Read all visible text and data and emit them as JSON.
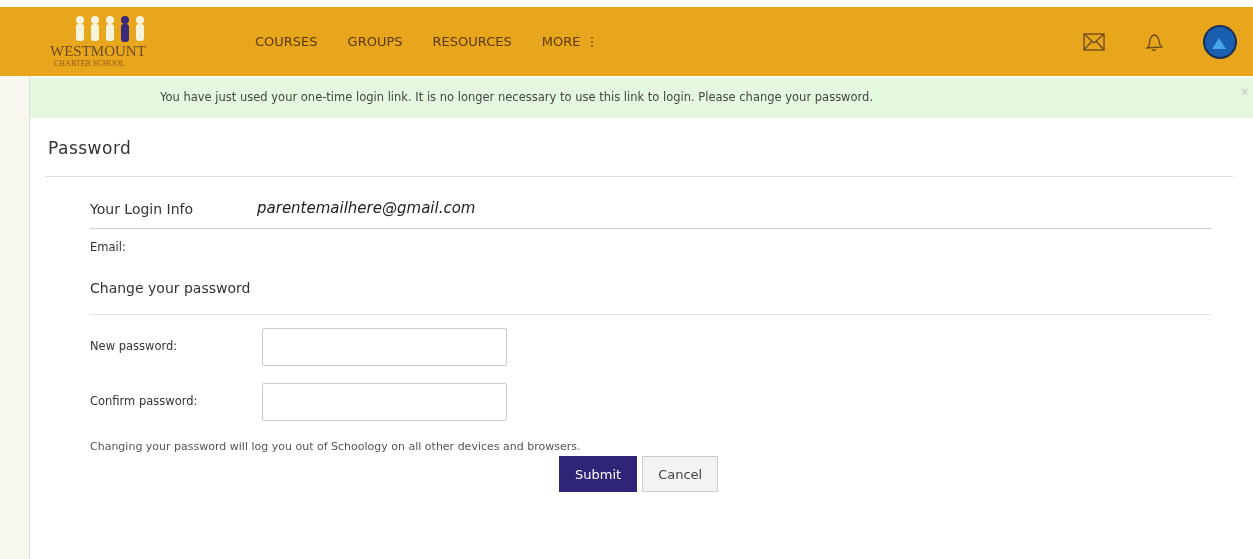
{
  "header": {
    "logo": {
      "name": "WESTMOUNT",
      "subtitle": "CHARTER SCHOOL"
    },
    "nav": [
      {
        "label": "COURSES"
      },
      {
        "label": "GROUPS"
      },
      {
        "label": "RESOURCES"
      },
      {
        "label": "MORE",
        "menu_icon": "⋮"
      }
    ]
  },
  "message": {
    "text": "You have just used your one-time login link. It is no longer necessary to use this link to login. Please change your password.",
    "close": "×"
  },
  "page_title": "Password",
  "login_info": {
    "heading": "Your Login Info",
    "email": "parentemailhere@gmail.com",
    "label": "Email:"
  },
  "change_password": {
    "heading": "Change your password",
    "fields": [
      {
        "label": "New password:"
      },
      {
        "label": "Confirm password:"
      }
    ],
    "note": "Changing your password will log you out of Schoology on all other devices and browsers.",
    "buttons": [
      {
        "label": "Submit",
        "kind": "primary"
      },
      {
        "label": "Cancel",
        "kind": "secondary"
      }
    ]
  }
}
